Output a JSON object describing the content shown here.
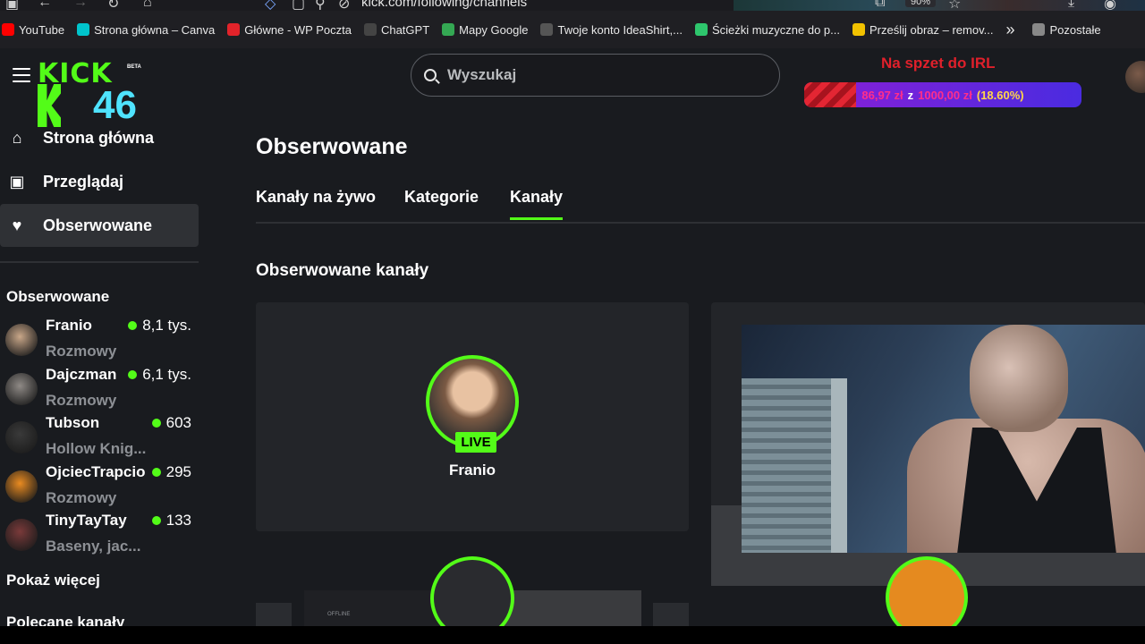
{
  "browser": {
    "url": "kick.com/following/channels",
    "zoom": "90%"
  },
  "bookmarks": [
    {
      "label": "YouTube",
      "icon": "youtube-icon",
      "color": "#ff0000"
    },
    {
      "label": "Strona główna – Canva",
      "icon": "canva-icon",
      "color": "#00c4cc"
    },
    {
      "label": "Główne - WP Poczta",
      "icon": "wp-icon",
      "color": "#e2232a"
    },
    {
      "label": "ChatGPT",
      "icon": "chatgpt-icon",
      "color": "#444"
    },
    {
      "label": "Mapy Google",
      "icon": "maps-pin-icon",
      "color": "#34a853"
    },
    {
      "label": "Twoje konto IdeaShirt,...",
      "icon": "shirt-icon",
      "color": "#555"
    },
    {
      "label": "Ścieżki muzyczne do p...",
      "icon": "pixabay-icon",
      "color": "#2ec66d"
    },
    {
      "label": "Prześlij obraz – remov...",
      "icon": "remove-bg-icon",
      "color": "#f2c200"
    },
    {
      "label": "Pozostałe",
      "icon": "folder-icon",
      "color": "#888"
    }
  ],
  "header": {
    "logo_text": "KICK",
    "logo_beta": "BETA",
    "logo_number": "46",
    "search_placeholder": "Wyszukaj",
    "goal": {
      "title": "Na spzet do IRL",
      "current": "86,97 zł",
      "sep": "z",
      "target": "1000,00 zł",
      "percent_label": "(18.60%)",
      "percent": 18.6
    }
  },
  "sidebar": {
    "nav": [
      {
        "label": "Strona główna",
        "icon": "home-icon"
      },
      {
        "label": "Przeglądaj",
        "icon": "browse-icon"
      },
      {
        "label": "Obserwowane",
        "icon": "heart-icon",
        "active": true
      }
    ],
    "following_header": "Obserwowane",
    "channels": [
      {
        "name": "Franio",
        "viewers": "8,1 tys.",
        "category": "Rozmowy",
        "avatar": "#c9a789"
      },
      {
        "name": "Dajczman",
        "viewers": "6,1 tys.",
        "category": "Rozmowy",
        "avatar": "#8f8a86"
      },
      {
        "name": "Tubson",
        "viewers": "603",
        "category": "Hollow Knig...",
        "avatar": "#3a3a3a"
      },
      {
        "name": "OjciecTrapcio",
        "viewers": "295",
        "category": "Rozmowy",
        "avatar": "#e98b21"
      },
      {
        "name": "TinyTayTay",
        "viewers": "133",
        "category": "Baseny, jac...",
        "avatar": "#7a3a3a"
      }
    ],
    "show_more": "Pokaż więcej",
    "recommended_header": "Polecane kanały"
  },
  "main": {
    "title": "Obserwowane",
    "tabs": [
      {
        "label": "Kanały na żywo"
      },
      {
        "label": "Kategorie"
      },
      {
        "label": "Kanały",
        "active": true
      }
    ],
    "section_title": "Obserwowane kanały",
    "cards": [
      {
        "name": "Franio",
        "badge": "LIVE"
      }
    ],
    "offline_label": "OFFLINE"
  }
}
